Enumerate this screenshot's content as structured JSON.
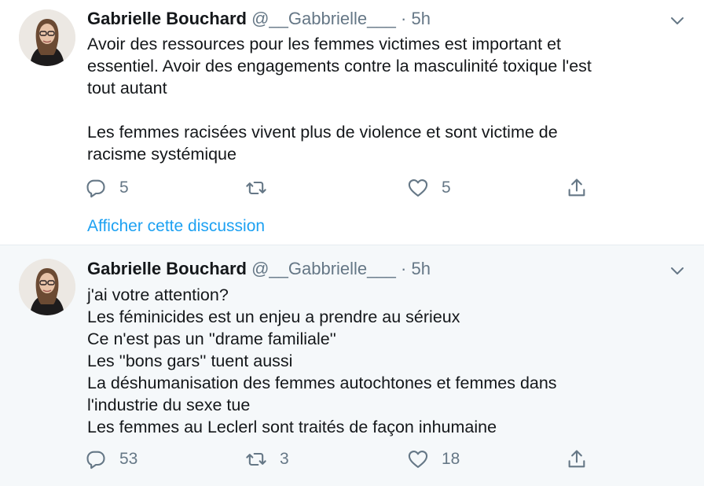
{
  "tweets": [
    {
      "author": "Gabrielle Bouchard",
      "handle": "@__Gabbrielle___",
      "separator": "·",
      "time": "5h",
      "lines": [
        "Avoir des ressources pour les femmes victimes est important et",
        "essentiel. Avoir des engagements contre la masculinité toxique l'est",
        "tout autant",
        "",
        "Les femmes racisées vivent plus de violence et sont victime de",
        "racisme systémique"
      ],
      "replies": "5",
      "retweets": "",
      "likes": "5",
      "show_thread": "Afficher cette discussion"
    },
    {
      "author": "Gabrielle Bouchard",
      "handle": "@__Gabbrielle___",
      "separator": "·",
      "time": "5h",
      "lines": [
        "j'ai votre attention?",
        "Les féminicides est un enjeu a prendre au sérieux",
        "Ce n'est pas un ''drame familiale''",
        "Les ''bons gars'' tuent aussi",
        "La déshumanisation des femmes autochtones et femmes dans",
        "l'industrie du sexe tue",
        "Les femmes au Leclerl sont traités de façon inhumaine"
      ],
      "replies": "53",
      "retweets": "3",
      "likes": "18"
    }
  ],
  "icons": {
    "reply": "reply-icon",
    "retweet": "retweet-icon",
    "like": "heart-icon",
    "share": "share-icon",
    "caret": "chevron-down-icon"
  },
  "colors": {
    "text": "#14171a",
    "secondary": "#657786",
    "link": "#1da1f2",
    "highlight_background": "#f5f8fa"
  }
}
